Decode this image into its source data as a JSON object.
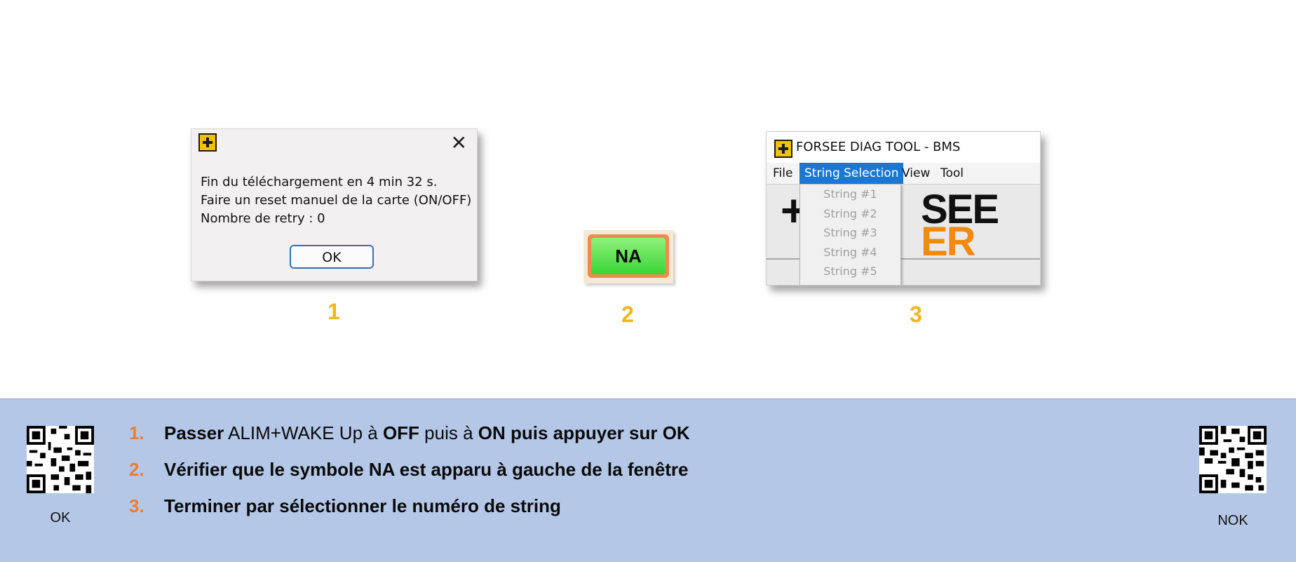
{
  "dialog": {
    "lines": [
      "Fin du téléchargement en 4 min 32 s.",
      "Faire un reset manuel de la carte (ON/OFF)",
      "Nombre de retry : 0"
    ],
    "ok_label": "OK",
    "close_glyph": "✕"
  },
  "step_numbers": [
    "1",
    "2",
    "3"
  ],
  "indicator": {
    "label": "NA"
  },
  "window": {
    "title": "FORSEE DIAG TOOL - BMS",
    "menus": [
      "File",
      "String Selection",
      "View",
      "Tool"
    ],
    "dropdown_items": [
      "String #1",
      "String #2",
      "String #3",
      "String #4",
      "String #5"
    ],
    "logo_top": "SEE",
    "logo_bottom": "ER",
    "logo_plus": "+"
  },
  "instructions": [
    {
      "num": "1.",
      "parts": [
        {
          "text": "Passer",
          "bold": true
        },
        {
          "text": " ALIM+WAKE Up à ",
          "bold": false
        },
        {
          "text": "OFF",
          "bold": true
        },
        {
          "text": " puis à ",
          "bold": false
        },
        {
          "text": "ON puis appuyer sur OK",
          "bold": true
        }
      ]
    },
    {
      "num": "2.",
      "parts": [
        {
          "text": "Vérifier que le symbole NA est apparu à gauche de la fenêtre",
          "bold": true
        }
      ]
    },
    {
      "num": "3.",
      "parts": [
        {
          "text": "Terminer par sélectionner le numéro de string",
          "bold": true
        }
      ]
    }
  ],
  "qr_left_label": "OK",
  "qr_right_label": "NOK",
  "colors": {
    "panel_bg": "#b4c7e7",
    "step_number": "#f0b620",
    "list_number": "#ed7d31",
    "menu_active": "#1a78d4"
  }
}
